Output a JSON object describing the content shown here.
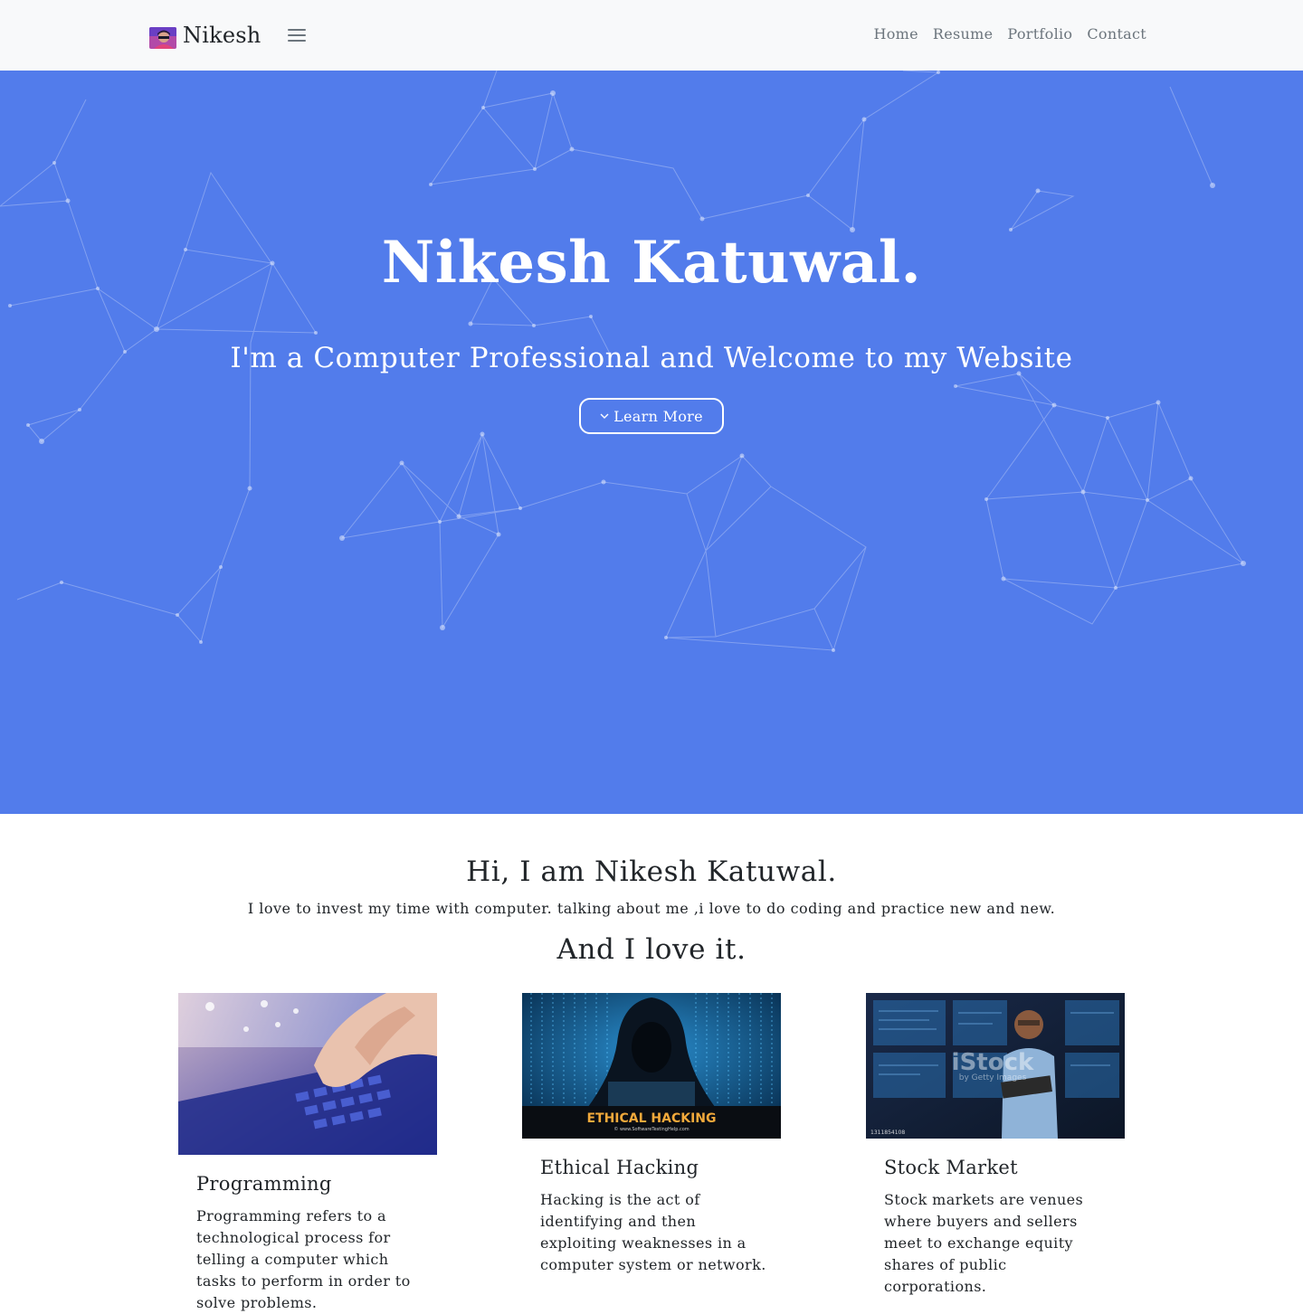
{
  "navbar": {
    "brand": "Nikesh",
    "links": [
      "Home",
      "Resume",
      "Portfolio",
      "Contact"
    ]
  },
  "hero": {
    "title": "Nikesh Katuwal.",
    "subtitle": "I'm a Computer Professional and Welcome to my Website",
    "button_label": "Learn More",
    "background_color": "#527ceb"
  },
  "about": {
    "title": "Hi, I am Nikesh Katuwal.",
    "text": "I love to invest my time with computer. talking about me ,i love to do coding and practice new and new.",
    "love": "And I love it."
  },
  "cards": [
    {
      "title": "Programming",
      "text": "Programming refers to a technological process for telling a computer which tasks to perform in order to solve problems.",
      "image": "laptop-keyboard-photo"
    },
    {
      "title": "Ethical Hacking",
      "text": "Hacking is the act of identifying and then exploiting weaknesses in a computer system or network.",
      "image": "hooded-hacker-photo",
      "image_caption": "ETHICAL HACKING",
      "image_credit": "© www.SoftwareTestingHelp.com"
    },
    {
      "title": "Stock Market",
      "text": "Stock markets are venues where buyers and sellers meet to exchange equity shares of public corporations.",
      "image": "trader-with-laptop-photo",
      "watermark": "iStock",
      "watermark_sub": "by Getty Images",
      "stock_id": "1311854108"
    }
  ]
}
